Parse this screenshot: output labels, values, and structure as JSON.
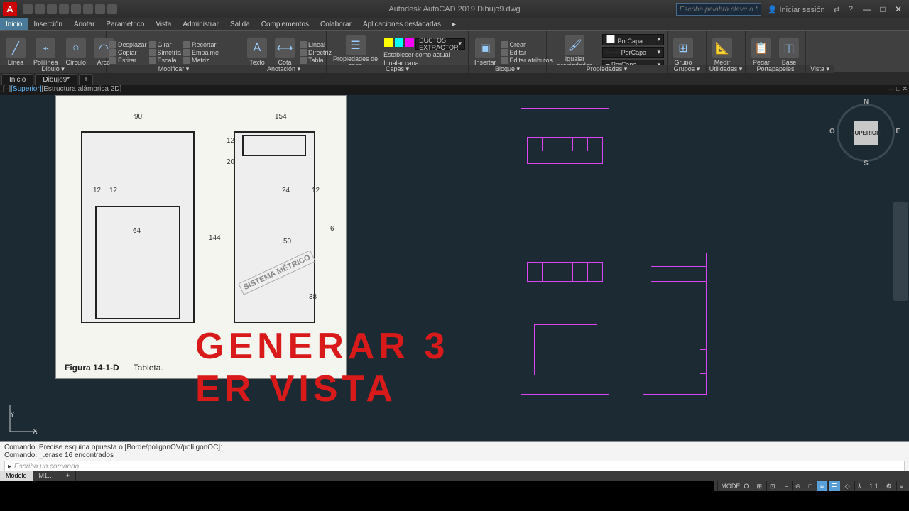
{
  "titlebar": {
    "logo": "A",
    "title": "Autodesk AutoCAD 2019   Dibujo9.dwg",
    "search_placeholder": "Escriba palabra clave o frase",
    "signin": "Iniciar sesión",
    "min": "—",
    "max": "□",
    "close": "✕"
  },
  "ribtabs": [
    "Inicio",
    "Inserción",
    "Anotar",
    "Paramétrico",
    "Vista",
    "Administrar",
    "Salida",
    "Complementos",
    "Colaborar",
    "Aplicaciones destacadas"
  ],
  "ribtabs_active": 0,
  "ribbon": {
    "dibujo": {
      "title": "Dibujo ▾",
      "linea": "Línea",
      "polilinea": "Polilínea",
      "circulo": "Círculo",
      "arco": "Arco"
    },
    "modificar": {
      "title": "Modificar ▾",
      "items": [
        "Desplazar",
        "Girar",
        "Recortar",
        "Copiar",
        "Simetría",
        "Empalme",
        "Estirar",
        "Escala",
        "Matriz"
      ]
    },
    "anotacion": {
      "title": "Anotación ▾",
      "texto": "Texto",
      "cota": "Cota",
      "lineal": "Lineal",
      "directriz": "Directriz",
      "tabla": "Tabla"
    },
    "capas": {
      "title": "Capas ▾",
      "btn": "Propiedades\nde capa",
      "dd": "DUCTOS EXTRACTOR",
      "set": "Establecer como actual",
      "match": "Igualar capa"
    },
    "bloque": {
      "title": "Bloque ▾",
      "insertar": "Insertar",
      "crear": "Crear",
      "editar": "Editar",
      "attr": "Editar atributos"
    },
    "propiedades": {
      "title": "Propiedades ▾",
      "btn": "Igualar\npropiedades",
      "color": "PorCapa",
      "line": "PorCapa",
      "wt": "PorCapa"
    },
    "grupos": {
      "title": "Grupos ▾",
      "grupo": "Grupo"
    },
    "util": {
      "title": "Utilidades ▾",
      "medir": "Medir"
    },
    "porta": {
      "title": "Portapapeles",
      "pegar": "Pegar",
      "base": "Base"
    },
    "vista": {
      "title": "Vista ▾"
    }
  },
  "filetabs": {
    "inicio": "Inicio",
    "dwg": "Dibujo9*",
    "plus": "+"
  },
  "bcrumb": {
    "a": "[–]",
    "b": "[Superior]",
    "c": "[Estructura alámbrica 2D]"
  },
  "refimg": {
    "dims": {
      "d90": "90",
      "d154": "154",
      "d12a": "12",
      "d20": "20",
      "d12b": "12",
      "d12c": "12",
      "d24": "24",
      "d12d": "12",
      "d64": "64",
      "d144": "144",
      "d50": "50",
      "d6": "6",
      "d38": "38"
    },
    "stamp": "SISTEMA\nMÉTRICO",
    "caption_a": "Figura  14-1-D",
    "caption_b": "Tableta."
  },
  "overlay": "GENERAR 3\nER VISTA",
  "viewcube": {
    "face": "SUPERIOR",
    "n": "N",
    "s": "S",
    "e": "E",
    "w": "O"
  },
  "cmds": {
    "l1": "Comando: Precise esquina opuesta o [Borde/poligonOV/políigonOC]:",
    "l2": "Comando: _.erase 16 encontrados",
    "prompt": "Escriba un comando"
  },
  "layouts": {
    "model": "Modelo",
    "m1": "M1…"
  },
  "status": {
    "model": "MODELO",
    "ratio": "1:1",
    "snap": "⊞",
    "grid": "⊡",
    "ortho": "└",
    "polar": "⊕",
    "osnap": "□",
    "dyn": "≡",
    "lwt": "≣",
    "iso": "◇",
    "anno": "⅄",
    "gear": "⚙",
    "menu": "≡"
  }
}
